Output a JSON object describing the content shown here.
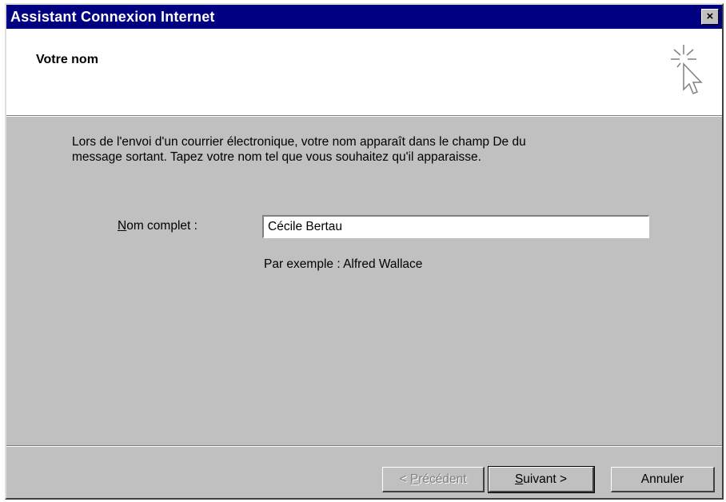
{
  "window": {
    "title": "Assistant Connexion Internet",
    "close_glyph": "×"
  },
  "header": {
    "title": "Votre nom",
    "icon": "wizard-sparkle-cursor-icon"
  },
  "intro": {
    "text_line1": "Lors de l'envoi d'un courrier électronique, votre nom apparaît dans le champ De du",
    "text_line2": "message sortant. Tapez votre nom tel que vous souhaitez qu'il apparaisse."
  },
  "form": {
    "name_label_accel": "N",
    "name_label_rest": "om complet :",
    "name_value": "Cécile Bertau",
    "example": "Par exemple : Alfred Wallace"
  },
  "buttons": {
    "prev_prefix": "< ",
    "prev_accel": "P",
    "prev_rest": "récédent",
    "next_accel": "S",
    "next_rest": "uivant >",
    "cancel": "Annuler"
  },
  "colors": {
    "titlebar": "#000080",
    "face": "#c0c0c0",
    "header_bg": "#ffffff"
  }
}
